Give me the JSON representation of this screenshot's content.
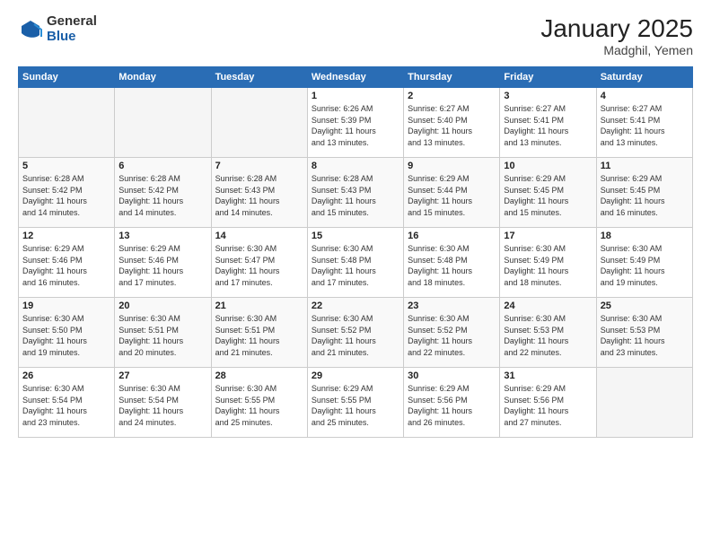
{
  "header": {
    "logo_general": "General",
    "logo_blue": "Blue",
    "month": "January 2025",
    "location": "Madghil, Yemen"
  },
  "days_of_week": [
    "Sunday",
    "Monday",
    "Tuesday",
    "Wednesday",
    "Thursday",
    "Friday",
    "Saturday"
  ],
  "weeks": [
    {
      "days": [
        {
          "num": "",
          "info": ""
        },
        {
          "num": "",
          "info": ""
        },
        {
          "num": "",
          "info": ""
        },
        {
          "num": "1",
          "info": "Sunrise: 6:26 AM\nSunset: 5:39 PM\nDaylight: 11 hours\nand 13 minutes."
        },
        {
          "num": "2",
          "info": "Sunrise: 6:27 AM\nSunset: 5:40 PM\nDaylight: 11 hours\nand 13 minutes."
        },
        {
          "num": "3",
          "info": "Sunrise: 6:27 AM\nSunset: 5:41 PM\nDaylight: 11 hours\nand 13 minutes."
        },
        {
          "num": "4",
          "info": "Sunrise: 6:27 AM\nSunset: 5:41 PM\nDaylight: 11 hours\nand 13 minutes."
        }
      ]
    },
    {
      "days": [
        {
          "num": "5",
          "info": "Sunrise: 6:28 AM\nSunset: 5:42 PM\nDaylight: 11 hours\nand 14 minutes."
        },
        {
          "num": "6",
          "info": "Sunrise: 6:28 AM\nSunset: 5:42 PM\nDaylight: 11 hours\nand 14 minutes."
        },
        {
          "num": "7",
          "info": "Sunrise: 6:28 AM\nSunset: 5:43 PM\nDaylight: 11 hours\nand 14 minutes."
        },
        {
          "num": "8",
          "info": "Sunrise: 6:28 AM\nSunset: 5:43 PM\nDaylight: 11 hours\nand 15 minutes."
        },
        {
          "num": "9",
          "info": "Sunrise: 6:29 AM\nSunset: 5:44 PM\nDaylight: 11 hours\nand 15 minutes."
        },
        {
          "num": "10",
          "info": "Sunrise: 6:29 AM\nSunset: 5:45 PM\nDaylight: 11 hours\nand 15 minutes."
        },
        {
          "num": "11",
          "info": "Sunrise: 6:29 AM\nSunset: 5:45 PM\nDaylight: 11 hours\nand 16 minutes."
        }
      ]
    },
    {
      "days": [
        {
          "num": "12",
          "info": "Sunrise: 6:29 AM\nSunset: 5:46 PM\nDaylight: 11 hours\nand 16 minutes."
        },
        {
          "num": "13",
          "info": "Sunrise: 6:29 AM\nSunset: 5:46 PM\nDaylight: 11 hours\nand 17 minutes."
        },
        {
          "num": "14",
          "info": "Sunrise: 6:30 AM\nSunset: 5:47 PM\nDaylight: 11 hours\nand 17 minutes."
        },
        {
          "num": "15",
          "info": "Sunrise: 6:30 AM\nSunset: 5:48 PM\nDaylight: 11 hours\nand 17 minutes."
        },
        {
          "num": "16",
          "info": "Sunrise: 6:30 AM\nSunset: 5:48 PM\nDaylight: 11 hours\nand 18 minutes."
        },
        {
          "num": "17",
          "info": "Sunrise: 6:30 AM\nSunset: 5:49 PM\nDaylight: 11 hours\nand 18 minutes."
        },
        {
          "num": "18",
          "info": "Sunrise: 6:30 AM\nSunset: 5:49 PM\nDaylight: 11 hours\nand 19 minutes."
        }
      ]
    },
    {
      "days": [
        {
          "num": "19",
          "info": "Sunrise: 6:30 AM\nSunset: 5:50 PM\nDaylight: 11 hours\nand 19 minutes."
        },
        {
          "num": "20",
          "info": "Sunrise: 6:30 AM\nSunset: 5:51 PM\nDaylight: 11 hours\nand 20 minutes."
        },
        {
          "num": "21",
          "info": "Sunrise: 6:30 AM\nSunset: 5:51 PM\nDaylight: 11 hours\nand 21 minutes."
        },
        {
          "num": "22",
          "info": "Sunrise: 6:30 AM\nSunset: 5:52 PM\nDaylight: 11 hours\nand 21 minutes."
        },
        {
          "num": "23",
          "info": "Sunrise: 6:30 AM\nSunset: 5:52 PM\nDaylight: 11 hours\nand 22 minutes."
        },
        {
          "num": "24",
          "info": "Sunrise: 6:30 AM\nSunset: 5:53 PM\nDaylight: 11 hours\nand 22 minutes."
        },
        {
          "num": "25",
          "info": "Sunrise: 6:30 AM\nSunset: 5:53 PM\nDaylight: 11 hours\nand 23 minutes."
        }
      ]
    },
    {
      "days": [
        {
          "num": "26",
          "info": "Sunrise: 6:30 AM\nSunset: 5:54 PM\nDaylight: 11 hours\nand 23 minutes."
        },
        {
          "num": "27",
          "info": "Sunrise: 6:30 AM\nSunset: 5:54 PM\nDaylight: 11 hours\nand 24 minutes."
        },
        {
          "num": "28",
          "info": "Sunrise: 6:30 AM\nSunset: 5:55 PM\nDaylight: 11 hours\nand 25 minutes."
        },
        {
          "num": "29",
          "info": "Sunrise: 6:29 AM\nSunset: 5:55 PM\nDaylight: 11 hours\nand 25 minutes."
        },
        {
          "num": "30",
          "info": "Sunrise: 6:29 AM\nSunset: 5:56 PM\nDaylight: 11 hours\nand 26 minutes."
        },
        {
          "num": "31",
          "info": "Sunrise: 6:29 AM\nSunset: 5:56 PM\nDaylight: 11 hours\nand 27 minutes."
        },
        {
          "num": "",
          "info": ""
        }
      ]
    }
  ]
}
